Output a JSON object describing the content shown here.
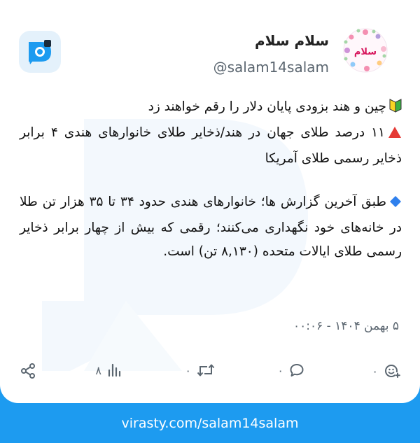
{
  "post": {
    "display_name": "سلام سلام",
    "username": "@salam14salam",
    "avatar_text": "سلام",
    "paragraph1_line1": "چین و هند بزودی پایان دلار را رقم خواهند  زد",
    "paragraph1_line2": "۱۱ درصد طلای جهان در هند/ذخایر طلای خانوارهای هندی ۴ برابر ذخایر رسمی طلای آمریکا",
    "paragraph2": "طبق آخرین گزارش ها؛ خانوارهای هندی حدود ۳۴ تا ۳۵ هزار تن طلا در خانه‌های خود نگهداری می‌کنند؛ رقمی که بیش از چهار برابر ذخایر رسمی طلای ایالات متحده (۸,۱۳۰ تن) است.",
    "timestamp": "۵ بهمن ۱۴۰۴ - ۰۰:۰۶"
  },
  "actions": {
    "reactions_count": "۰",
    "comments_count": "۰",
    "reposts_count": "۰",
    "views_count": "۸"
  },
  "footer": {
    "url": "virasty.com/salam14salam"
  },
  "colors": {
    "brand": "#1d9bf0",
    "text_secondary": "#5b6670"
  },
  "icons": {
    "paragraph1_line1": "beginner-symbol-icon",
    "paragraph1_line2": "red-triangle-icon",
    "paragraph2": "blue-diamond-icon"
  }
}
